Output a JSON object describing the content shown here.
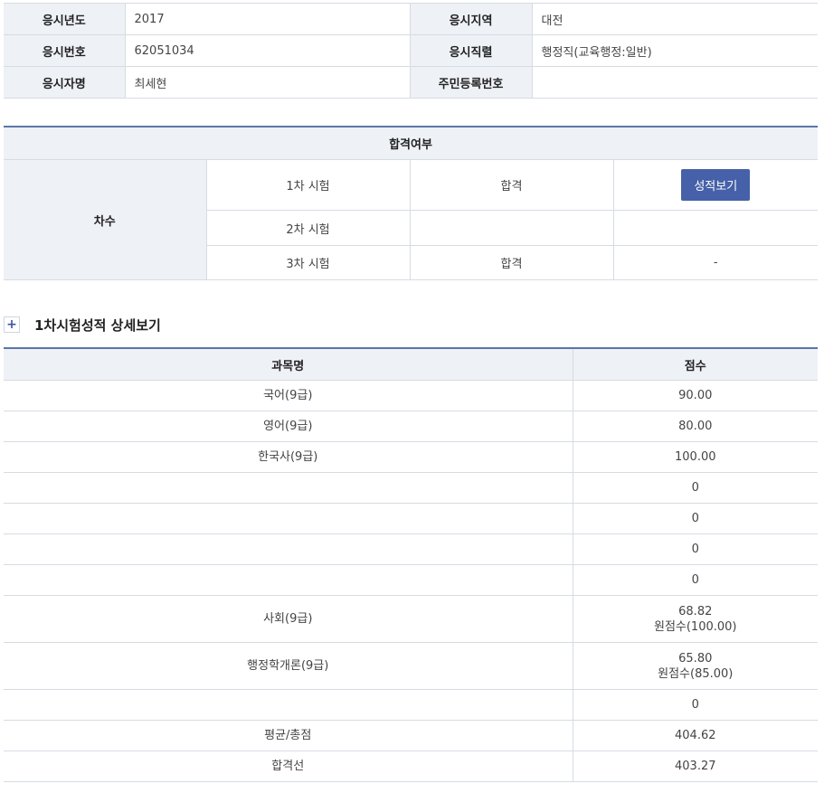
{
  "applicant": {
    "year_label": "응시년도",
    "year": "2017",
    "region_label": "응시지역",
    "region": "대전",
    "number_label": "응시번호",
    "number": "62051034",
    "position_label": "응시직렬",
    "position": "행정직(교육행정:일반)",
    "name_label": "응시자명",
    "name": "최세현",
    "id_label": "주민등록번호",
    "id": ""
  },
  "result": {
    "header": "합격여부",
    "round_label": "차수",
    "rows": [
      {
        "exam": "1차 시험",
        "status": "합격",
        "action": "성적보기"
      },
      {
        "exam": "2차 시험",
        "status": "",
        "action": ""
      },
      {
        "exam": "3차 시험",
        "status": "합격",
        "action": "-"
      }
    ]
  },
  "detail": {
    "title": "1차시험성적 상세보기",
    "plus_icon": "+",
    "col_subject": "과목명",
    "col_score": "점수",
    "rows": [
      {
        "subject": "국어(9급)",
        "score": "90.00",
        "raw": ""
      },
      {
        "subject": "영어(9급)",
        "score": "80.00",
        "raw": ""
      },
      {
        "subject": "한국사(9급)",
        "score": "100.00",
        "raw": ""
      },
      {
        "subject": "",
        "score": "0",
        "raw": ""
      },
      {
        "subject": "",
        "score": "0",
        "raw": ""
      },
      {
        "subject": "",
        "score": "0",
        "raw": ""
      },
      {
        "subject": "",
        "score": "0",
        "raw": ""
      },
      {
        "subject": "사회(9급)",
        "score": "68.82",
        "raw": "원점수(100.00)"
      },
      {
        "subject": "행정학개론(9급)",
        "score": "65.80",
        "raw": "원점수(85.00)"
      },
      {
        "subject": "",
        "score": "0",
        "raw": ""
      },
      {
        "subject": "평균/총점",
        "score": "404.62",
        "raw": ""
      },
      {
        "subject": "합격선",
        "score": "403.27",
        "raw": ""
      }
    ]
  },
  "colors": {
    "header_bg": "#eef1f6",
    "accent": "#5a76a8",
    "button": "#4661a9"
  }
}
